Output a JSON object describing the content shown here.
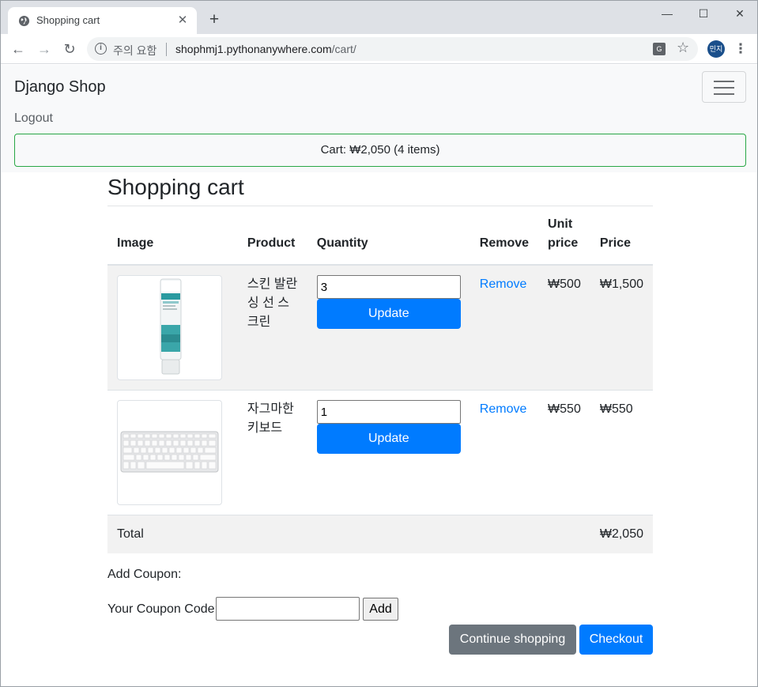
{
  "browser": {
    "tab_title": "Shopping cart",
    "security_label": "주의 요함",
    "url_host": "shophmj1.pythonanywhere.com",
    "url_path": "/cart/",
    "profile_initials": "민지"
  },
  "navbar": {
    "brand": "Django Shop",
    "logout": "Logout",
    "cart_summary": "Cart: ₩2,050 (4 items)"
  },
  "page": {
    "title": "Shopping cart"
  },
  "table": {
    "headers": {
      "image": "Image",
      "product": "Product",
      "quantity": "Quantity",
      "remove": "Remove",
      "unit_price": "Unit price",
      "price": "Price"
    },
    "items": [
      {
        "product": "스킨 발란싱 선 스크린",
        "quantity": "3",
        "update_label": "Update",
        "remove_label": "Remove",
        "unit_price": "₩500",
        "price": "₩1,500",
        "image_icon": "sunscreen-tube-image"
      },
      {
        "product": "자그마한 키보드",
        "quantity": "1",
        "update_label": "Update",
        "remove_label": "Remove",
        "unit_price": "₩550",
        "price": "₩550",
        "image_icon": "keyboard-image"
      }
    ],
    "total_label": "Total",
    "total_value": "₩2,050"
  },
  "coupon": {
    "heading": "Add Coupon:",
    "field_label": "Your Coupon Code:",
    "value": "",
    "add_label": "Add"
  },
  "actions": {
    "continue_label": "Continue shopping",
    "checkout_label": "Checkout"
  },
  "colors": {
    "primary": "#007bff",
    "secondary": "#6c757d",
    "success_border": "#28a745",
    "navbar_bg": "#f8f9fa"
  }
}
